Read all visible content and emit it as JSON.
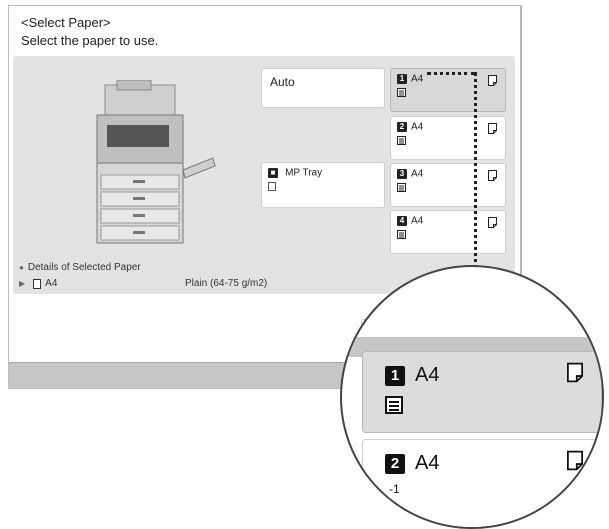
{
  "header": {
    "title": "<Select Paper>",
    "subtitle": "Select the paper to use."
  },
  "sources": {
    "auto_label": "Auto",
    "mp_tray": {
      "label": "MP Tray",
      "number": "■"
    },
    "drawers": [
      {
        "number": "1",
        "size": "A4",
        "selected": true
      },
      {
        "number": "2",
        "size": "A4",
        "selected": false
      },
      {
        "number": "3",
        "size": "A4",
        "selected": false
      },
      {
        "number": "4",
        "size": "A4",
        "selected": false
      }
    ]
  },
  "details": {
    "label": "Details of Selected Paper",
    "size": "A4",
    "type": "Plain (64-75 g/m2)"
  },
  "magnified": {
    "items": [
      {
        "number": "1",
        "size": "A4"
      },
      {
        "number": "2",
        "size": "A4"
      }
    ],
    "partial_mark": "-1"
  }
}
